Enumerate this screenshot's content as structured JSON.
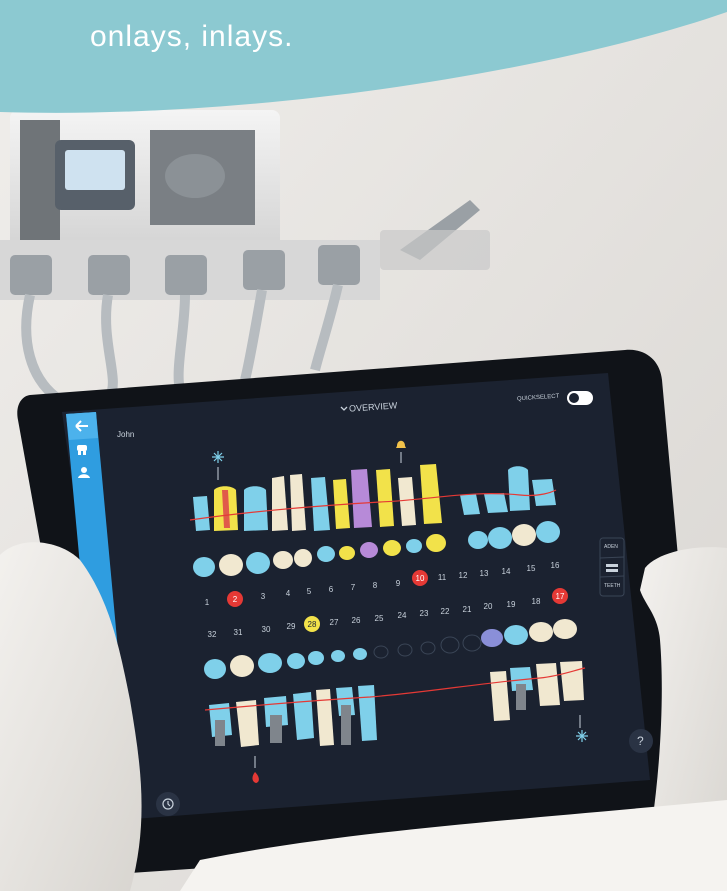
{
  "banner": {
    "text": "onlays, inlays."
  },
  "app": {
    "title": "OVERVIEW",
    "patient_name": "John",
    "quickselect_label": "QUICKSELECT",
    "help_label": "?",
    "view_toggle": [
      "ADEN",
      "",
      "TEETH"
    ]
  },
  "tooth_numbers": {
    "upper": [
      "1",
      "2",
      "3",
      "4",
      "5",
      "6",
      "7",
      "8",
      "9",
      "10",
      "11",
      "12",
      "13",
      "14",
      "15",
      "16"
    ],
    "lower": [
      "32",
      "31",
      "30",
      "29",
      "28",
      "27",
      "26",
      "25",
      "24",
      "23",
      "22",
      "21",
      "20",
      "19",
      "18",
      "17"
    ]
  },
  "colors": {
    "banner": "#8cc9d1",
    "screen_bg": "#1b2230",
    "sidebar": "#2f9de0",
    "alert_red": "#e53935",
    "highlight_yellow": "#f2e24a",
    "tooth_blue": "#7fd0ea",
    "tooth_purple": "#b78ad8"
  }
}
